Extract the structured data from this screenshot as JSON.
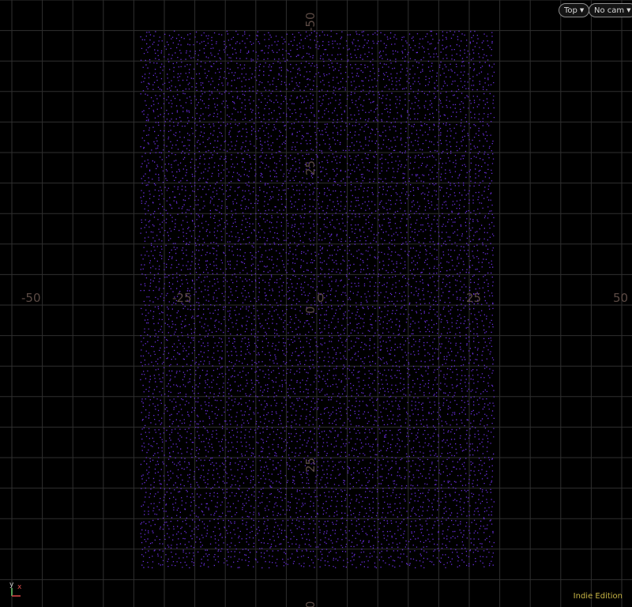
{
  "viewport": {
    "view_menu": "Top",
    "camera_menu": "No cam",
    "edition_label": "Indie Edition",
    "background_color": "#000000",
    "grid_color": "#2f2f2f",
    "point_color": "#6a2fe0",
    "grid_spacing_units": 5,
    "horizontal_axis_labels": [
      "-50",
      "-25",
      "0",
      "25",
      "50"
    ],
    "vertical_axis_labels": [
      "-50",
      "25",
      "0",
      "25",
      "0"
    ],
    "gizmo": {
      "y_label": "y",
      "x_label": "x"
    }
  },
  "point_cloud": {
    "x_range": [
      -29,
      29
    ],
    "z_range": [
      -45,
      43
    ],
    "point_spacing_units": 0.75
  }
}
